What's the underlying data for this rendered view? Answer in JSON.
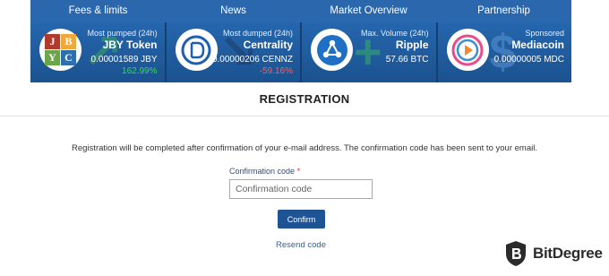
{
  "nav": [
    "Fees & limits",
    "News",
    "Market Overview",
    "Partnership"
  ],
  "cards": [
    {
      "heading": "Most pumped (24h)",
      "name": "JBY Token",
      "price": "0.00001589 JBY",
      "change": "162.99%",
      "change_color": "#3cd65a",
      "ghost": "↗",
      "ghost_color": "#34a85a",
      "logo": "jby-logo-icon",
      "logo_letters": [
        "J",
        "B",
        "Y",
        "C"
      ],
      "logo_colors": [
        "#b23a2c",
        "#f0a838",
        "#6aa54a",
        "#2e6fb0"
      ]
    },
    {
      "heading": "Most dumped (24h)",
      "name": "Centrality",
      "price": "0.00000206 CENNZ",
      "change": "-59.16%",
      "change_color": "#ff5a5a",
      "ghost": "↘",
      "ghost_color": "#1a3e6a",
      "logo": "centrality-logo-icon"
    },
    {
      "heading": "Max. Volume (24h)",
      "name": "Ripple",
      "price": "57.66 BTC",
      "change": "",
      "change_color": "",
      "ghost": "+",
      "ghost_color": "#38b06a",
      "logo": "ripple-logo-icon"
    },
    {
      "heading": "Sponsored",
      "name": "Mediacoin",
      "price": "0.00000005 MDC",
      "change": "",
      "change_color": "",
      "ghost": "$",
      "ghost_color": "#5a96d6",
      "logo": "mediacoin-logo-icon"
    }
  ],
  "page": {
    "title": "REGISTRATION",
    "message": "Registration will be completed after confirmation of your e-mail address. The confirmation code has been sent to your email.",
    "field_label": "Confirmation code",
    "field_required": "*",
    "field_placeholder": "Confirmation code",
    "confirm_label": "Confirm",
    "resend_label": "Resend code"
  },
  "watermark": {
    "text": "BitDegree",
    "icon": "bitdegree-shield-icon"
  }
}
